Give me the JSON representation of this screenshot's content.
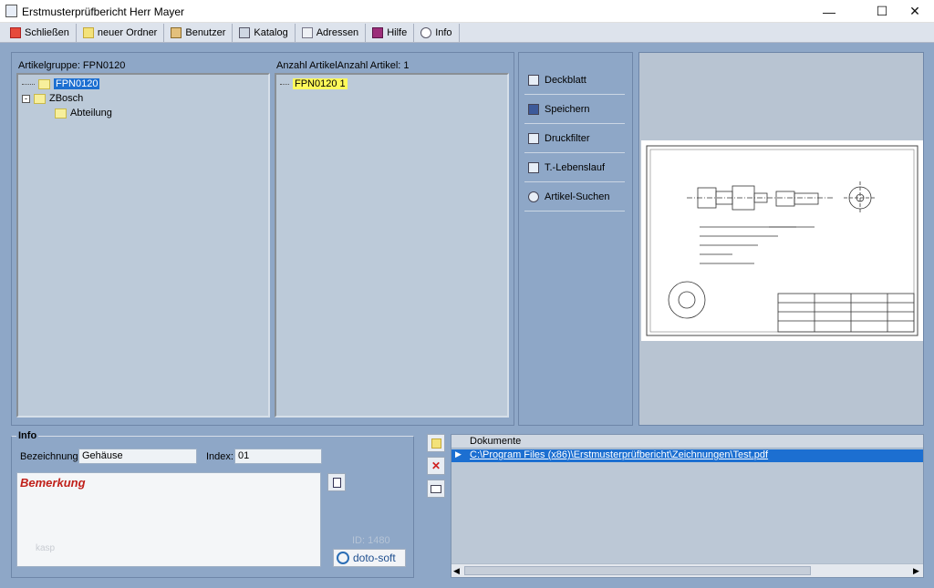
{
  "window": {
    "title": "Erstmusterprüfbericht Herr Mayer"
  },
  "toolbar": {
    "items": [
      {
        "label": "Schließen",
        "icon": "close-icon"
      },
      {
        "label": "neuer Ordner",
        "icon": "folder-icon"
      },
      {
        "label": "Benutzer",
        "icon": "user-icon"
      },
      {
        "label": "Katalog",
        "icon": "catalog-icon"
      },
      {
        "label": "Adressen",
        "icon": "address-icon"
      },
      {
        "label": "Hilfe",
        "icon": "help-book-icon"
      },
      {
        "label": "Info",
        "icon": "info-icon"
      }
    ]
  },
  "left_tree": {
    "header": "Artikelgruppe: FPN0120",
    "nodes": [
      {
        "label": "FPN0120",
        "level": 1,
        "selected": true
      },
      {
        "label": "ZBosch",
        "level": 1,
        "selected": false
      },
      {
        "label": "Abteilung",
        "level": 2,
        "selected": false
      }
    ]
  },
  "mid_tree": {
    "header": "Anzahl ArtikelAnzahl Artikel: 1",
    "nodes": [
      {
        "label": "FPN0120  1"
      }
    ]
  },
  "side_buttons": [
    {
      "label": "Deckblatt",
      "icon": "cover-page-icon"
    },
    {
      "label": "Speichern",
      "icon": "save-icon"
    },
    {
      "label": "Druckfilter",
      "icon": "print-icon"
    },
    {
      "label": "T.-Lebenslauf",
      "icon": "lifecycle-icon"
    },
    {
      "label": "Artikel-Suchen",
      "icon": "search-icon"
    }
  ],
  "info": {
    "legend": "Info",
    "bezeichnung_label": "Bezeichnung:",
    "bezeichnung_value": "Gehäuse",
    "index_label": "Index:",
    "index_value": "01",
    "bemerkung_label": "Bemerkung",
    "faded_text": "kasp",
    "id_text": "ID: 1480",
    "logo_text": "doto-soft"
  },
  "documents": {
    "header": "Dokumente",
    "rows": [
      "C:\\Program Files (x86)\\Erstmusterprüfbericht\\Zeichnungen\\Test.pdf"
    ]
  },
  "colors": {
    "panel": "#8ea7c7",
    "selection": "#1c6fd1",
    "highlight": "#fff95a",
    "bemerkung": "#c0201a"
  }
}
